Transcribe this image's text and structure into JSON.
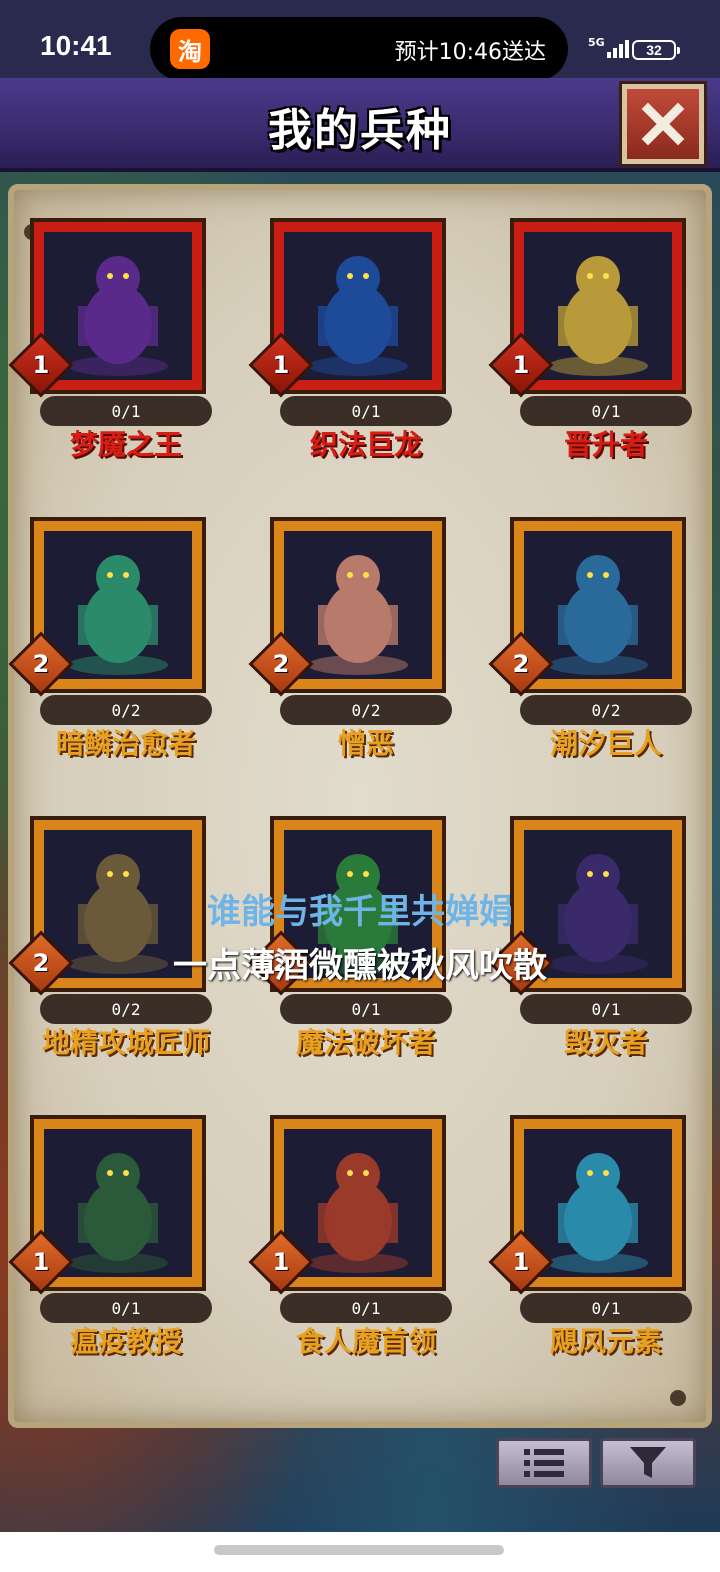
{
  "status_bar": {
    "time": "10:41",
    "app_icon_glyph": "淘",
    "delivery_text": "预计10:46送达",
    "network": "5G",
    "battery": "32"
  },
  "header": {
    "title": "我的兵种"
  },
  "units": [
    {
      "name": "梦魇之王",
      "count": "0/1",
      "tier": "1",
      "rarity": "red",
      "icon": "nightmare-king-portrait"
    },
    {
      "name": "织法巨龙",
      "count": "0/1",
      "tier": "1",
      "rarity": "red",
      "icon": "spellweaver-dragon-portrait"
    },
    {
      "name": "晋升者",
      "count": "0/1",
      "tier": "1",
      "rarity": "red",
      "icon": "ascendant-portrait"
    },
    {
      "name": "暗鳞治愈者",
      "count": "0/2",
      "tier": "2",
      "rarity": "orange",
      "icon": "darkscale-healer-portrait"
    },
    {
      "name": "憎恶",
      "count": "0/2",
      "tier": "2",
      "rarity": "orange",
      "icon": "abomination-portrait"
    },
    {
      "name": "潮汐巨人",
      "count": "0/2",
      "tier": "2",
      "rarity": "orange",
      "icon": "tide-giant-portrait"
    },
    {
      "name": "地精攻城匠师",
      "count": "0/2",
      "tier": "2",
      "rarity": "orange",
      "icon": "goblin-siege-engineer-portrait"
    },
    {
      "name": "魔法破坏者",
      "count": "0/1",
      "tier": "2",
      "rarity": "orange",
      "icon": "spellbreaker-portrait"
    },
    {
      "name": "毁灭者",
      "count": "0/1",
      "tier": "2",
      "rarity": "orange",
      "icon": "destroyer-portrait"
    },
    {
      "name": "瘟疫教授",
      "count": "0/1",
      "tier": "1",
      "rarity": "orange",
      "icon": "plague-professor-portrait"
    },
    {
      "name": "食人魔首领",
      "count": "0/1",
      "tier": "1",
      "rarity": "orange",
      "icon": "ogre-chieftain-portrait"
    },
    {
      "name": "飓风元素",
      "count": "0/1",
      "tier": "1",
      "rarity": "orange",
      "icon": "hurricane-elemental-portrait"
    }
  ],
  "lyrics": {
    "line1": "谁能与我千里共婵娟",
    "line2": "一点薄酒微醺被秋风吹散"
  },
  "colors": {
    "red_frame": "#c81e14",
    "orange_frame": "#d9851a",
    "header_bg": "#3a2a6e"
  }
}
